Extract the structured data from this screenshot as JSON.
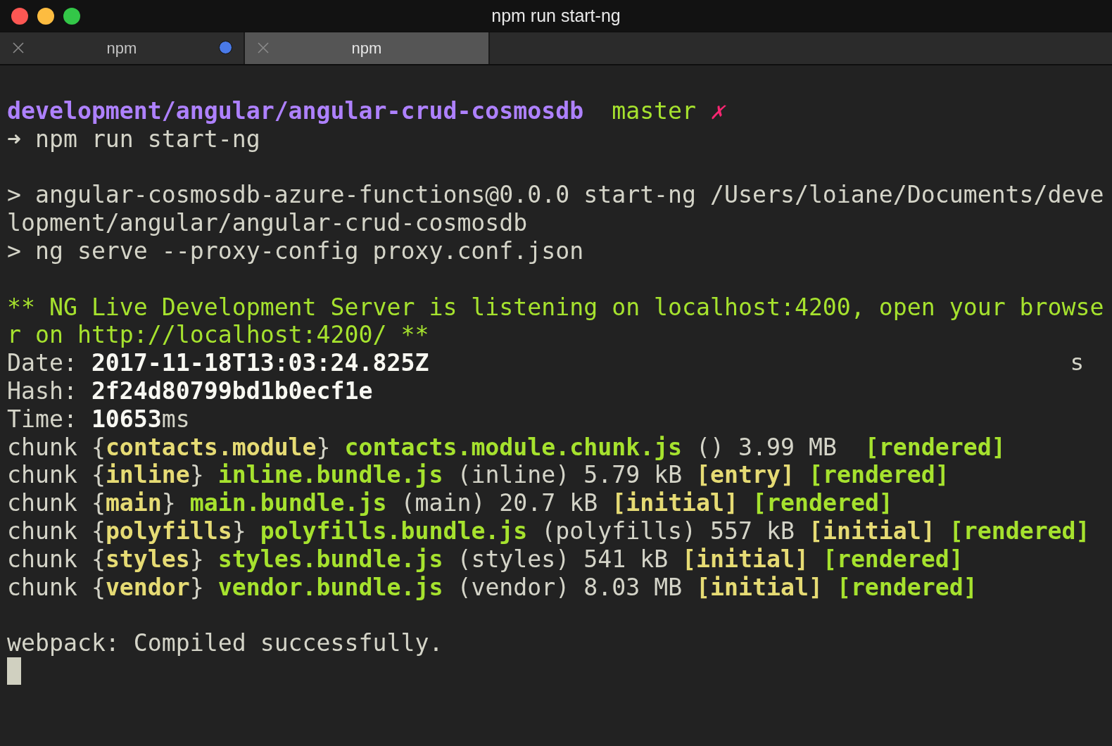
{
  "window": {
    "title": "npm run start-ng"
  },
  "tabs": [
    {
      "label": "npm",
      "selected": false,
      "activity": true
    },
    {
      "label": "npm",
      "selected": true,
      "activity": false
    }
  ],
  "lines": [
    {
      "kind": "text",
      "segments": [
        {
          "kind": "path",
          "text": "development/angular/angular-crud-cosmosdb"
        },
        {
          "kind": "branch",
          "text": "  master "
        },
        {
          "kind": "mark",
          "text": "✗"
        }
      ]
    },
    {
      "kind": "text",
      "segments": [
        {
          "kind": "plain",
          "text": "➜ npm run start-ng"
        }
      ]
    },
    {
      "kind": "blank"
    },
    {
      "kind": "text",
      "segments": [
        {
          "kind": "plain",
          "text": "> angular-cosmosdb-azure-functions@0.0.0 start-ng /Users/loiane/Documents/deve"
        }
      ]
    },
    {
      "kind": "text",
      "segments": [
        {
          "kind": "plain",
          "text": "lopment/angular/angular-crud-cosmosdb"
        }
      ]
    },
    {
      "kind": "text",
      "segments": [
        {
          "kind": "plain",
          "text": "> ng serve --proxy-config proxy.conf.json"
        }
      ]
    },
    {
      "kind": "blank"
    },
    {
      "kind": "text",
      "segments": [
        {
          "kind": "info",
          "text": "** NG Live Development Server is listening on localhost:4200, open your browse"
        }
      ]
    },
    {
      "kind": "text",
      "segments": [
        {
          "kind": "info",
          "text": "r on http://localhost:4200/ **"
        }
      ]
    },
    {
      "kind": "text",
      "right_text": "s",
      "segments": [
        {
          "kind": "plain",
          "text": "Date: "
        },
        {
          "kind": "bold",
          "text": "2017-11-18T13:03:24.825Z"
        }
      ]
    },
    {
      "kind": "text",
      "segments": [
        {
          "kind": "plain",
          "text": "Hash: "
        },
        {
          "kind": "bold",
          "text": "2f24d80799bd1b0ecf1e"
        }
      ]
    },
    {
      "kind": "text",
      "segments": [
        {
          "kind": "plain",
          "text": "Time: "
        },
        {
          "kind": "bold",
          "text": "10653"
        },
        {
          "kind": "plain",
          "text": "ms"
        }
      ]
    },
    {
      "kind": "text",
      "segments": [
        {
          "kind": "plain",
          "text": "chunk {"
        },
        {
          "kind": "yellow",
          "text": "contacts.module"
        },
        {
          "kind": "plain",
          "text": "} "
        },
        {
          "kind": "green",
          "text": "contacts.module.chunk.js"
        },
        {
          "kind": "plain",
          "text": " () 3.99 MB  "
        },
        {
          "kind": "green",
          "text": "[rendered]"
        }
      ]
    },
    {
      "kind": "text",
      "segments": [
        {
          "kind": "plain",
          "text": "chunk {"
        },
        {
          "kind": "yellow",
          "text": "inline"
        },
        {
          "kind": "plain",
          "text": "} "
        },
        {
          "kind": "green",
          "text": "inline.bundle.js"
        },
        {
          "kind": "plain",
          "text": " (inline) 5.79 kB "
        },
        {
          "kind": "yellow",
          "text": "[entry] "
        },
        {
          "kind": "green",
          "text": "[rendered]"
        }
      ]
    },
    {
      "kind": "text",
      "segments": [
        {
          "kind": "plain",
          "text": "chunk {"
        },
        {
          "kind": "yellow",
          "text": "main"
        },
        {
          "kind": "plain",
          "text": "} "
        },
        {
          "kind": "green",
          "text": "main.bundle.js"
        },
        {
          "kind": "plain",
          "text": " (main) 20.7 kB "
        },
        {
          "kind": "yellow",
          "text": "[initial] "
        },
        {
          "kind": "green",
          "text": "[rendered]"
        }
      ]
    },
    {
      "kind": "text",
      "segments": [
        {
          "kind": "plain",
          "text": "chunk {"
        },
        {
          "kind": "yellow",
          "text": "polyfills"
        },
        {
          "kind": "plain",
          "text": "} "
        },
        {
          "kind": "green",
          "text": "polyfills.bundle.js"
        },
        {
          "kind": "plain",
          "text": " (polyfills) 557 kB "
        },
        {
          "kind": "yellow",
          "text": "[initial] "
        },
        {
          "kind": "green",
          "text": "[rendered]"
        }
      ]
    },
    {
      "kind": "text",
      "segments": [
        {
          "kind": "plain",
          "text": "chunk {"
        },
        {
          "kind": "yellow",
          "text": "styles"
        },
        {
          "kind": "plain",
          "text": "} "
        },
        {
          "kind": "green",
          "text": "styles.bundle.js"
        },
        {
          "kind": "plain",
          "text": " (styles) 541 kB "
        },
        {
          "kind": "yellow",
          "text": "[initial] "
        },
        {
          "kind": "green",
          "text": "[rendered]"
        }
      ]
    },
    {
      "kind": "text",
      "segments": [
        {
          "kind": "plain",
          "text": "chunk {"
        },
        {
          "kind": "yellow",
          "text": "vendor"
        },
        {
          "kind": "plain",
          "text": "} "
        },
        {
          "kind": "green",
          "text": "vendor.bundle.js"
        },
        {
          "kind": "plain",
          "text": " (vendor) 8.03 MB "
        },
        {
          "kind": "yellow",
          "text": "[initial] "
        },
        {
          "kind": "green",
          "text": "[rendered]"
        }
      ]
    },
    {
      "kind": "blank"
    },
    {
      "kind": "text",
      "segments": [
        {
          "kind": "plain",
          "text": "webpack: Compiled successfully."
        }
      ]
    }
  ],
  "cursor": {
    "kind": "block"
  }
}
